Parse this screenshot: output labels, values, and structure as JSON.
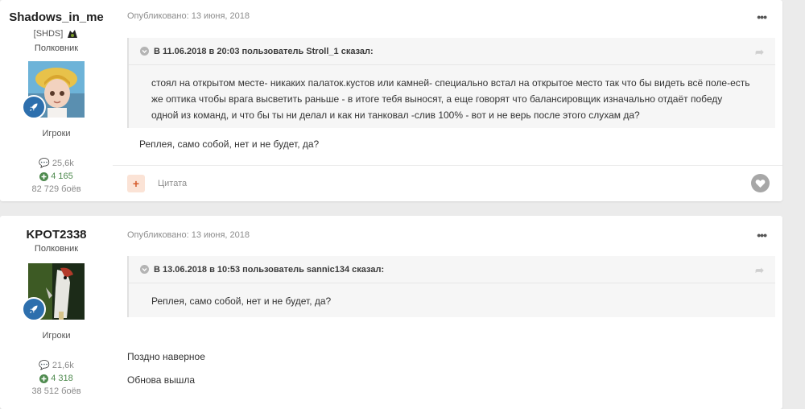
{
  "posts": [
    {
      "author": {
        "name": "Shadows_in_me",
        "clan": "[SHDS]",
        "rank": "Полковник",
        "group": "Игроки",
        "posts_count": "25,6k",
        "reputation": "4 165",
        "battles": "82 729 боёв"
      },
      "published": "Опубликовано: 13 июня, 2018",
      "quote": {
        "header": "В 11.06.2018 в 20:03 пользователь Stroll_1 сказал:",
        "text": "стоял на открытом месте- никаких палаток.кустов или камней- специально встал на открытое место так что бы видеть всё поле-есть же оптика чтобы врага высветить раньше - в итоге тебя выносят, а еще говорят что балансировщик изначально отдаёт победу одной из команд, и что бы ты ни делал и как ни танковал -слив 100% - вот и не верь после этого слухам да?"
      },
      "text": "Реплея, само собой, нет и не будет, да?",
      "footer": {
        "plus": "+",
        "quote_label": "Цитата"
      }
    },
    {
      "author": {
        "name": "KPOT2338",
        "rank": "Полковник",
        "group": "Игроки",
        "posts_count": "21,6k",
        "reputation": "4 318",
        "battles": "38 512 боёв"
      },
      "published": "Опубликовано: 13 июня, 2018",
      "quote": {
        "header": "В 13.06.2018 в 10:53 пользователь sannic134 сказал:",
        "text": "Реплея, само собой, нет и не будет, да?"
      },
      "lines": [
        "Поздно наверное",
        "Обнова вышла"
      ]
    }
  ],
  "menu_label": "•••",
  "colors": {
    "accent_orange": "#d55c2d",
    "badge_blue": "#2d6fad",
    "rep_green": "#4e8a4e"
  }
}
